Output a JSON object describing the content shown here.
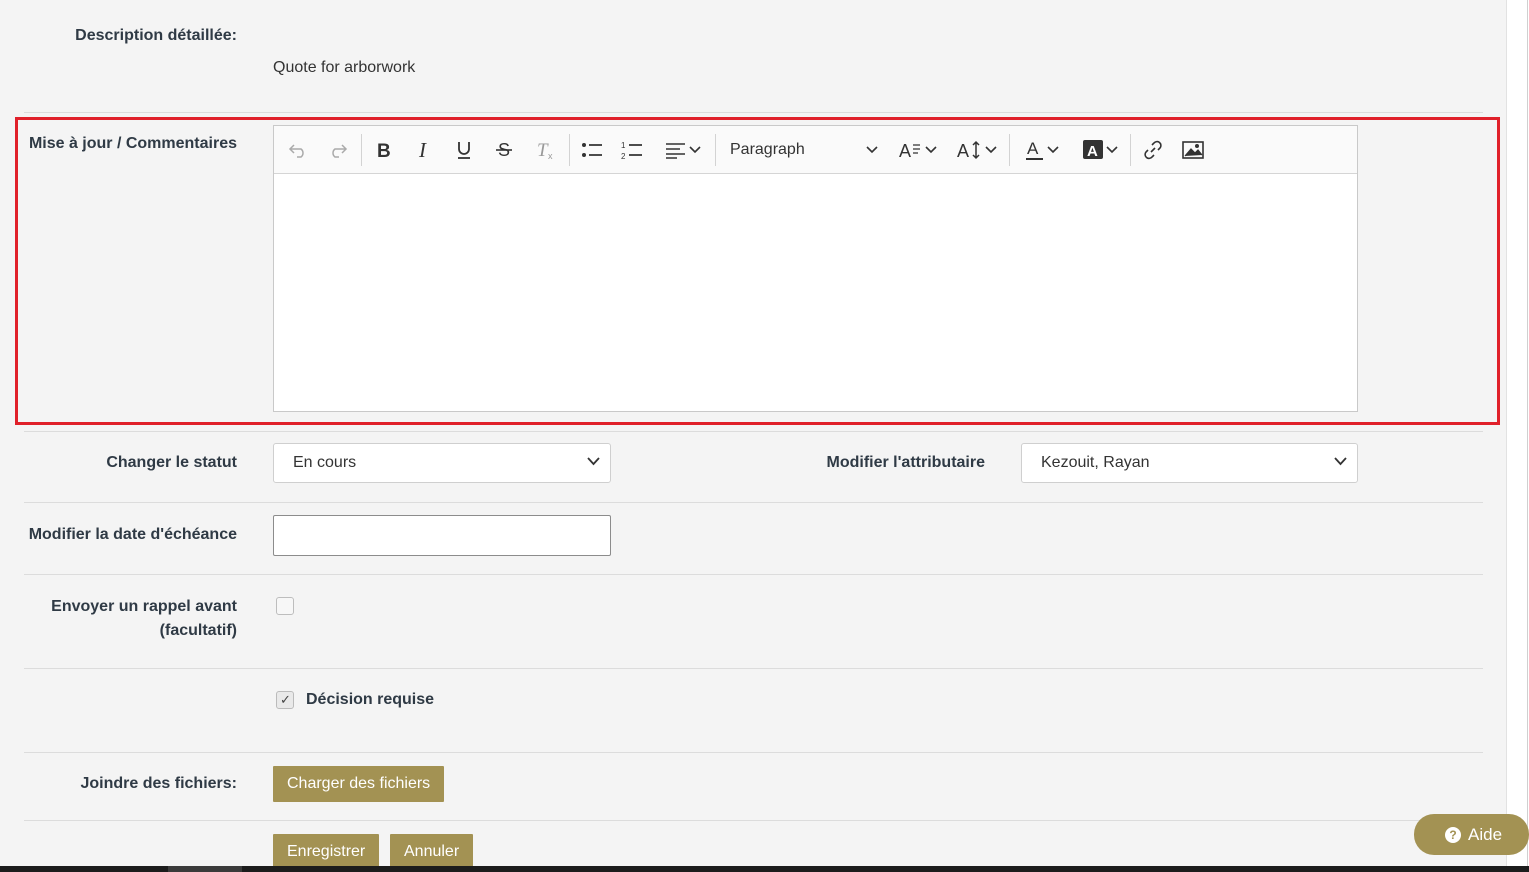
{
  "description": {
    "label": "Description détaillée:",
    "value": "Quote for arborwork"
  },
  "comments": {
    "label": "Mise à jour / Commentaires",
    "toolbar": {
      "paragraph_select": "Paragraph",
      "icons": [
        "undo-icon",
        "redo-icon",
        "bold-icon",
        "italic-icon",
        "underline-icon",
        "strikethrough-icon",
        "clear-format-icon",
        "bulleted-list-icon",
        "numbered-list-icon",
        "align-icon",
        "font-size-icon",
        "line-height-icon",
        "font-color-icon",
        "highlight-color-icon",
        "link-icon",
        "image-icon"
      ]
    },
    "content": ""
  },
  "status": {
    "label": "Changer le statut",
    "value": "En cours"
  },
  "assignee": {
    "label": "Modifier l'attributaire",
    "value": "Kezouit, Rayan"
  },
  "due_date": {
    "label": "Modifier la date d'échéance",
    "value": ""
  },
  "reminder": {
    "label_line1": "Envoyer un rappel avant",
    "label_line2": "(facultatif)",
    "checked": false
  },
  "decision": {
    "label": "Décision requise",
    "checked": true
  },
  "attachments": {
    "label": "Joindre des fichiers:",
    "button": "Charger des fichiers"
  },
  "actions": {
    "save": "Enregistrer",
    "cancel": "Annuler"
  },
  "help": {
    "label": "Aide"
  },
  "colors": {
    "accent": "#a39253",
    "highlight_border": "#e0202a",
    "panel_bg": "#f4f4f4"
  }
}
